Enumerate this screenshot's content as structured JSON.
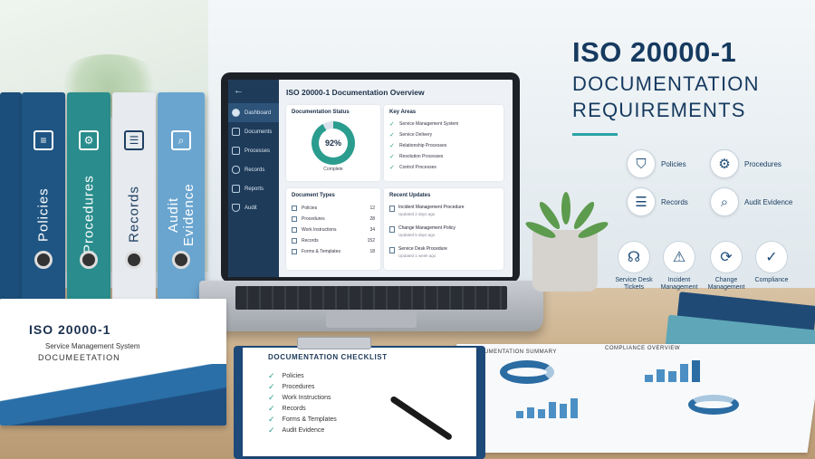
{
  "heading": {
    "line1": "ISO 20000-1",
    "line2": "DOCUMENTATION",
    "line3": "REQUIREMENTS"
  },
  "binders": [
    "Policies",
    "Procedures",
    "Records",
    "Audit Evidence"
  ],
  "dashboard": {
    "title": "ISO 20000-1 Documentation Overview",
    "nav": [
      {
        "label": "Dashboard",
        "icon": "pie-icon"
      },
      {
        "label": "Documents",
        "icon": "document-icon"
      },
      {
        "label": "Processes",
        "icon": "process-icon"
      },
      {
        "label": "Records",
        "icon": "database-icon"
      },
      {
        "label": "Reports",
        "icon": "chart-icon"
      },
      {
        "label": "Audit",
        "icon": "shield-icon"
      }
    ],
    "status": {
      "title": "Documentation Status",
      "percent": "92%",
      "percent_value": 92,
      "caption": "Complete"
    },
    "key_areas": {
      "title": "Key Areas",
      "items": [
        "Service Management System",
        "Service Delivery",
        "Relationship Processes",
        "Resolution Processes",
        "Control Processes"
      ]
    },
    "doc_types": {
      "title": "Document Types",
      "rows": [
        {
          "label": "Policies",
          "count": "12"
        },
        {
          "label": "Procedures",
          "count": "28"
        },
        {
          "label": "Work Instructions",
          "count": "34"
        },
        {
          "label": "Records",
          "count": "152"
        },
        {
          "label": "Forms & Templates",
          "count": "18"
        }
      ]
    },
    "updates": {
      "title": "Recent Updates",
      "items": [
        {
          "title": "Incident Management Procedure",
          "date": "Updated 2 days ago"
        },
        {
          "title": "Change Management Policy",
          "date": "Updated 5 days ago"
        },
        {
          "title": "Service Desk Procedure",
          "date": "Updated 1 week ago"
        }
      ]
    }
  },
  "icon_grid": [
    {
      "label": "Policies",
      "icon": "shield-check-icon"
    },
    {
      "label": "Procedures",
      "icon": "gear-icon"
    },
    {
      "label": "Records",
      "icon": "database-icon"
    },
    {
      "label": "Audit Evidence",
      "icon": "magnifier-icon"
    }
  ],
  "bottom_icons": [
    {
      "label": "Service Desk Tickets",
      "icon": "headset-icon"
    },
    {
      "label": "Incident Management",
      "icon": "warning-icon"
    },
    {
      "label": "Change Management",
      "icon": "cycle-icon"
    },
    {
      "label": "Compliance",
      "icon": "shield-check-icon"
    }
  ],
  "booklet": {
    "title": "ISO 20000-1",
    "subtitle": "Service Management System",
    "bottom": "DOCUMEETATION"
  },
  "checklist": {
    "title": "DOCUMENTATION CHECKLIST",
    "items": [
      "Policies",
      "Procedures",
      "Work Instructions",
      "Records",
      "Forms & Templates",
      "Audit Evidence"
    ]
  },
  "reports": {
    "left": "DOCUMENTATION SUMMARY",
    "right": "COMPLIANCE OVERVIEW"
  },
  "colors": {
    "navy": "#163a5f",
    "teal": "#2a9d8f",
    "sidebar": "#1e3b5a"
  }
}
